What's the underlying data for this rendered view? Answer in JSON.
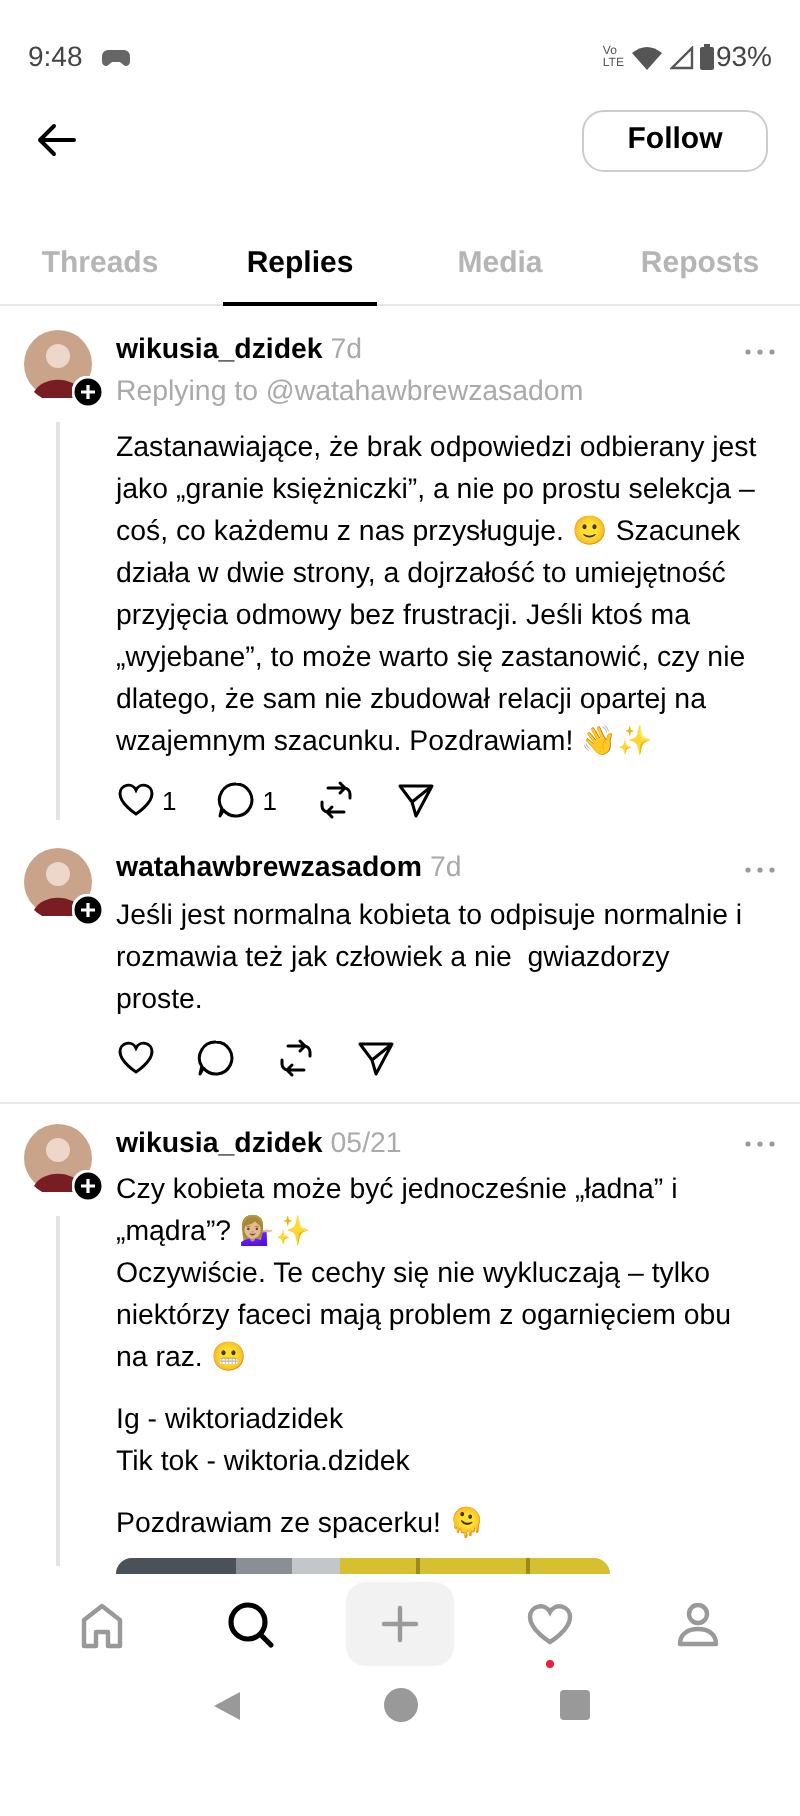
{
  "status_bar": {
    "time": "9:48",
    "network": [
      "Vo",
      "LTE"
    ],
    "battery": "93%"
  },
  "header": {
    "follow_button": "Follow"
  },
  "tabs": [
    {
      "label": "Threads",
      "selected": false
    },
    {
      "label": "Replies",
      "selected": true
    },
    {
      "label": "Media",
      "selected": false
    },
    {
      "label": "Reposts",
      "selected": false
    }
  ],
  "posts": [
    {
      "username": "wikusia_dzidek",
      "time": "7d",
      "action_bar": true,
      "replying_to": "Replying to @watahawbrewzasadom",
      "thread_line": true,
      "divider": false,
      "paragraphs": [
        "Zastanawiające, że brak odpowiedzi odbierany jest jako „granie księżniczki”, a nie po prostu selekcja – coś, co każdemu z nas przysługuje. 🙂 Szacunek działa w dwie strony, a dojrzałość to umiejętność przyjęcia odmowy bez frustracji. Jeśli ktoś ma „wyjebane”, to może warto się zastanowić, czy nie dlatego, że sam nie zbudował relacji opartej na wzajemnym szacunku. Pozdrawiam! 👋✨"
      ],
      "actions": {
        "likes": "1",
        "replies": "1"
      }
    },
    {
      "username": "watahawbrewzasadom",
      "time": "7d",
      "action_bar": true,
      "thread_line": false,
      "divider": true,
      "paragraphs": [
        "Jeśli jest normalna kobieta to odpisuje normalnie i rozmawia też jak człowiek a nie  gwiazdorzy proste."
      ]
    },
    {
      "username": "wikusia_dzidek",
      "time": "05/21",
      "action_bar": false,
      "thread_line": true,
      "divider": false,
      "paragraphs": [
        "Czy kobieta może być jednocześnie „ładna” i „mądra”? 💁🏼‍♀️✨\nOczywiście. Te cechy się nie wykluczają – tylko niektórzy faceci mają problem z ogarnięciem obu na raz. 😬",
        "Ig - wiktoriadzidek\nTik tok - wiktoria.dzidek",
        "Pozdrawiam ze spacerku! 🫠"
      ],
      "image": {
        "kind": "picture"
      }
    }
  ],
  "bottom_nav": [
    {
      "kind": "home",
      "selected": false,
      "unread": false
    },
    {
      "kind": "search",
      "selected": true,
      "unread": false
    },
    {
      "kind": "create",
      "selected": false,
      "unread": false
    },
    {
      "kind": "activity",
      "selected": false,
      "unread": true
    },
    {
      "kind": "profile",
      "selected": false,
      "unread": false
    }
  ]
}
